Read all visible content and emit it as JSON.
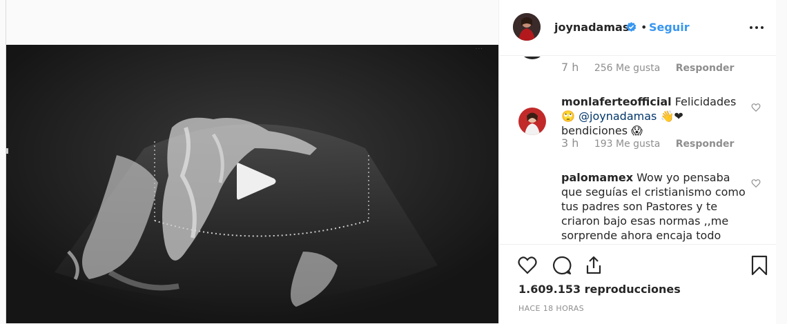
{
  "post": {
    "username": "joynadamas",
    "follow_label": "Seguir",
    "separator": "•"
  },
  "comments": [
    {
      "time": "7 h",
      "likes": "256 Me gusta",
      "reply": "Responder"
    },
    {
      "author": "monlaferteofficial",
      "text_part1": "Felicidades 🙄",
      "mention": "@joynadamas",
      "text_part2": "👋❤ bendiciones 😱",
      "time": "3 h",
      "likes": "193 Me gusta",
      "reply": "Responder"
    },
    {
      "author": "palomamex",
      "text": "Wow yo pensaba que seguías el cristianismo como tus padres son Pastores y te criaron bajo esas normas ,,me sorprende ahora encaja todo respecto a unas"
    }
  ],
  "stats": {
    "views": "1.609.153 reproducciones",
    "posted": "HACE 18 HORAS"
  },
  "icons": [
    "verified-icon",
    "more-options-icon",
    "play-icon",
    "heart-icon",
    "comment-icon",
    "share-icon",
    "bookmark-icon"
  ],
  "colors": {
    "link_blue": "#3897f0",
    "text": "#262626",
    "muted": "#8e8e8e",
    "border": "#dbdbdb"
  }
}
